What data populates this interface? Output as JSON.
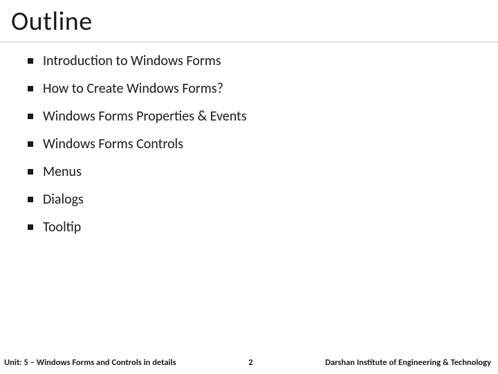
{
  "title": "Outline",
  "bullets": [
    "Introduction to Windows Forms",
    "How to Create Windows Forms?",
    "Windows Forms Properties & Events",
    "Windows Forms Controls",
    "Menus",
    "Dialogs",
    "Tooltip"
  ],
  "footer": {
    "left": "Unit: 5 – Windows Forms and Controls in details",
    "page": "2",
    "right": "Darshan Institute of Engineering & Technology"
  }
}
